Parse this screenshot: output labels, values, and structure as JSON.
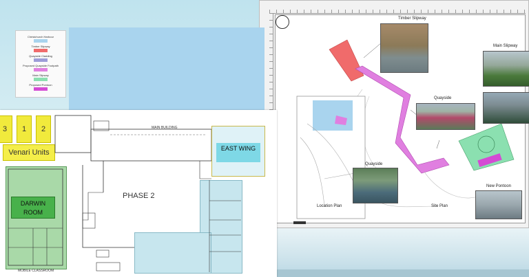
{
  "floor_plan": {
    "units": [
      "3",
      "1",
      "2"
    ],
    "units_label": "Venari Units",
    "darwin_room": "DARWIN ROOM",
    "east_wing": "EAST WING",
    "phase": "PHASE 2",
    "main_building": "MAIN BUILDING",
    "mobile_classroom": "MOBILE CLASSROOM"
  },
  "site_plan": {
    "top_label": "Timber Slipway",
    "legend": {
      "items": [
        {
          "label": "Christchurch Harbour",
          "color": "#a9d4ee"
        },
        {
          "label": "Timber Slipway",
          "color": "#e76464"
        },
        {
          "label": "Quayside Cladding",
          "color": "#9d9dd8"
        },
        {
          "label": "Proposed Quayside Footpath",
          "color": "#e78de0"
        },
        {
          "label": "Main Slipway",
          "color": "#8be0b0"
        },
        {
          "label": "Proposed Pontoon",
          "color": "#d44bd4"
        }
      ]
    },
    "photo_labels": {
      "main_slipway": "Main Slipway",
      "quayside": "Quayside",
      "quayside_2": "Quayside",
      "new_pontoon": "New Pontoon"
    },
    "location_plan": "Location Plan",
    "site_plan": "Site Plan"
  },
  "colors": {
    "timber": "#f06b6b",
    "footpath": "#e07fe0",
    "slipway": "#8be0b0",
    "pontoon": "#d44bd4",
    "water": "#a9d4ee"
  }
}
